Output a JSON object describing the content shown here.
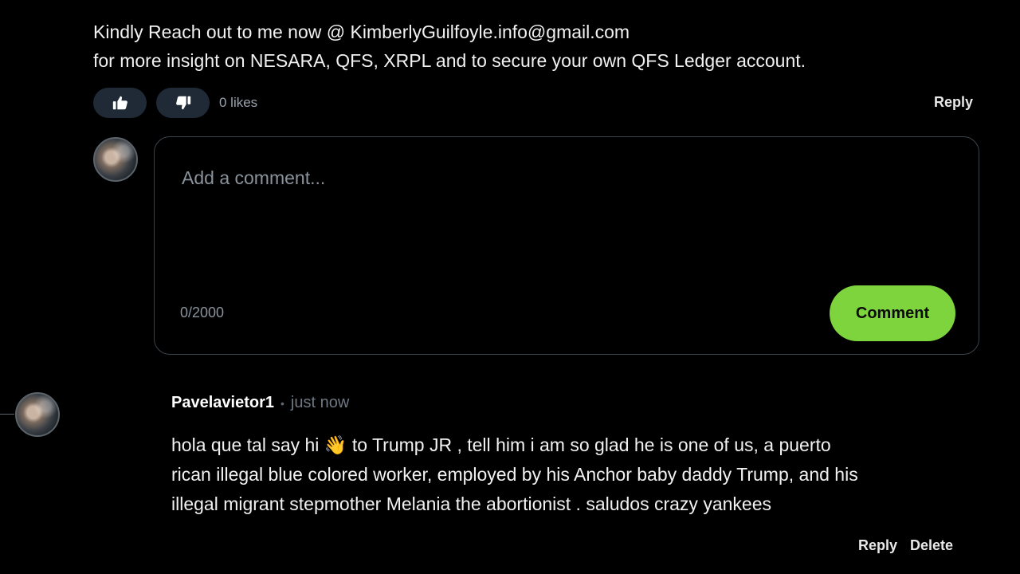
{
  "top_comment": {
    "lines": [
      "Kindly Reach out to me now @ KimberlyGuilfoyle.info@gmail.com",
      "for more insight on NESARA, QFS, XRPL and to secure your own QFS Ledger account."
    ],
    "likes_label": "0 likes",
    "reply_label": "Reply"
  },
  "composer": {
    "placeholder": "Add a comment...",
    "char_count": "0/2000",
    "submit_label": "Comment"
  },
  "reply_comment": {
    "author": "Pavelavietor1",
    "separator": "•",
    "time": "just now",
    "lines": [
      "hola que tal say hi 👋 to Trump JR , tell him i am so glad he is one of us, a puerto",
      "rican illegal blue colored worker, employed by his Anchor baby daddy Trump, and his",
      "illegal migrant stepmother Melania the abortionist . saludos crazy yankees"
    ],
    "actions": {
      "reply": "Reply",
      "delete": "Delete"
    }
  },
  "colors": {
    "background": "#000000",
    "accent": "#7ed43d",
    "vote_button": "#1f2a36",
    "border": "#3c434b"
  },
  "icons": {
    "like": "thumbs-up-icon",
    "dislike": "thumbs-down-icon"
  }
}
